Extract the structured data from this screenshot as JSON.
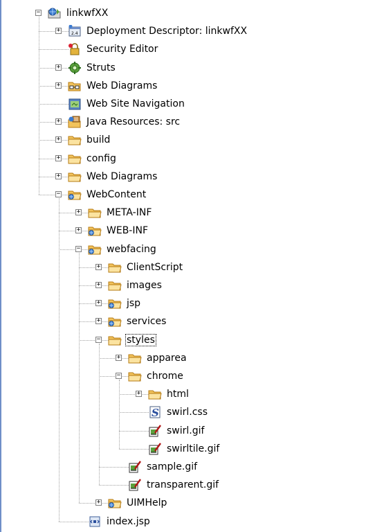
{
  "tree": [
    {
      "label": "linkwfXX",
      "depth": 0,
      "expander": "minus",
      "icon": "web-project-icon"
    },
    {
      "label": "Deployment Descriptor: linkwfXX",
      "depth": 1,
      "expander": "plus",
      "icon": "deployment-descriptor-icon"
    },
    {
      "label": "Security Editor",
      "depth": 1,
      "expander": "none",
      "icon": "security-editor-icon"
    },
    {
      "label": "Struts",
      "depth": 1,
      "expander": "plus",
      "icon": "struts-icon"
    },
    {
      "label": "Web Diagrams",
      "depth": 1,
      "expander": "plus",
      "icon": "web-diagram-icon"
    },
    {
      "label": "Web Site Navigation",
      "depth": 1,
      "expander": "none",
      "icon": "site-navigation-icon"
    },
    {
      "label": "Java Resources: src",
      "depth": 1,
      "expander": "plus",
      "icon": "java-resources-icon"
    },
    {
      "label": "build",
      "depth": 1,
      "expander": "plus",
      "icon": "folder-icon"
    },
    {
      "label": "config",
      "depth": 1,
      "expander": "plus",
      "icon": "folder-icon"
    },
    {
      "label": "Web Diagrams",
      "depth": 1,
      "expander": "plus",
      "icon": "folder-icon"
    },
    {
      "label": "WebContent",
      "depth": 1,
      "expander": "minus",
      "icon": "web-folder-icon"
    },
    {
      "label": "META-INF",
      "depth": 2,
      "expander": "plus",
      "icon": "folder-icon"
    },
    {
      "label": "WEB-INF",
      "depth": 2,
      "expander": "plus",
      "icon": "web-folder-icon"
    },
    {
      "label": "webfacing",
      "depth": 2,
      "expander": "minus",
      "icon": "web-folder-icon"
    },
    {
      "label": "ClientScript",
      "depth": 3,
      "expander": "plus",
      "icon": "folder-icon"
    },
    {
      "label": "images",
      "depth": 3,
      "expander": "plus",
      "icon": "folder-icon"
    },
    {
      "label": "jsp",
      "depth": 3,
      "expander": "plus",
      "icon": "web-folder-icon"
    },
    {
      "label": "services",
      "depth": 3,
      "expander": "plus",
      "icon": "web-folder-icon"
    },
    {
      "label": "styles",
      "depth": 3,
      "expander": "minus",
      "icon": "folder-icon",
      "focused": true
    },
    {
      "label": "apparea",
      "depth": 4,
      "expander": "plus",
      "icon": "folder-icon"
    },
    {
      "label": "chrome",
      "depth": 4,
      "expander": "minus",
      "icon": "folder-icon"
    },
    {
      "label": "html",
      "depth": 5,
      "expander": "plus",
      "icon": "folder-icon"
    },
    {
      "label": "swirl.css",
      "depth": 5,
      "expander": "none",
      "icon": "css-file-icon"
    },
    {
      "label": "swirl.gif",
      "depth": 5,
      "expander": "none",
      "icon": "gif-file-icon"
    },
    {
      "label": "swirltile.gif",
      "depth": 5,
      "expander": "none",
      "icon": "gif-file-icon"
    },
    {
      "label": "sample.gif",
      "depth": 4,
      "expander": "none",
      "icon": "gif-file-icon"
    },
    {
      "label": "transparent.gif",
      "depth": 4,
      "expander": "none",
      "icon": "gif-file-icon"
    },
    {
      "label": "UIMHelp",
      "depth": 3,
      "expander": "plus",
      "icon": "web-folder-icon"
    },
    {
      "label": "index.jsp",
      "depth": 2,
      "expander": "none",
      "icon": "jsp-file-icon"
    }
  ],
  "colors": {
    "folder": "#f2c35c",
    "folder_edge": "#b57b15",
    "guide": "#a0a0a0",
    "focus": "#000000"
  }
}
